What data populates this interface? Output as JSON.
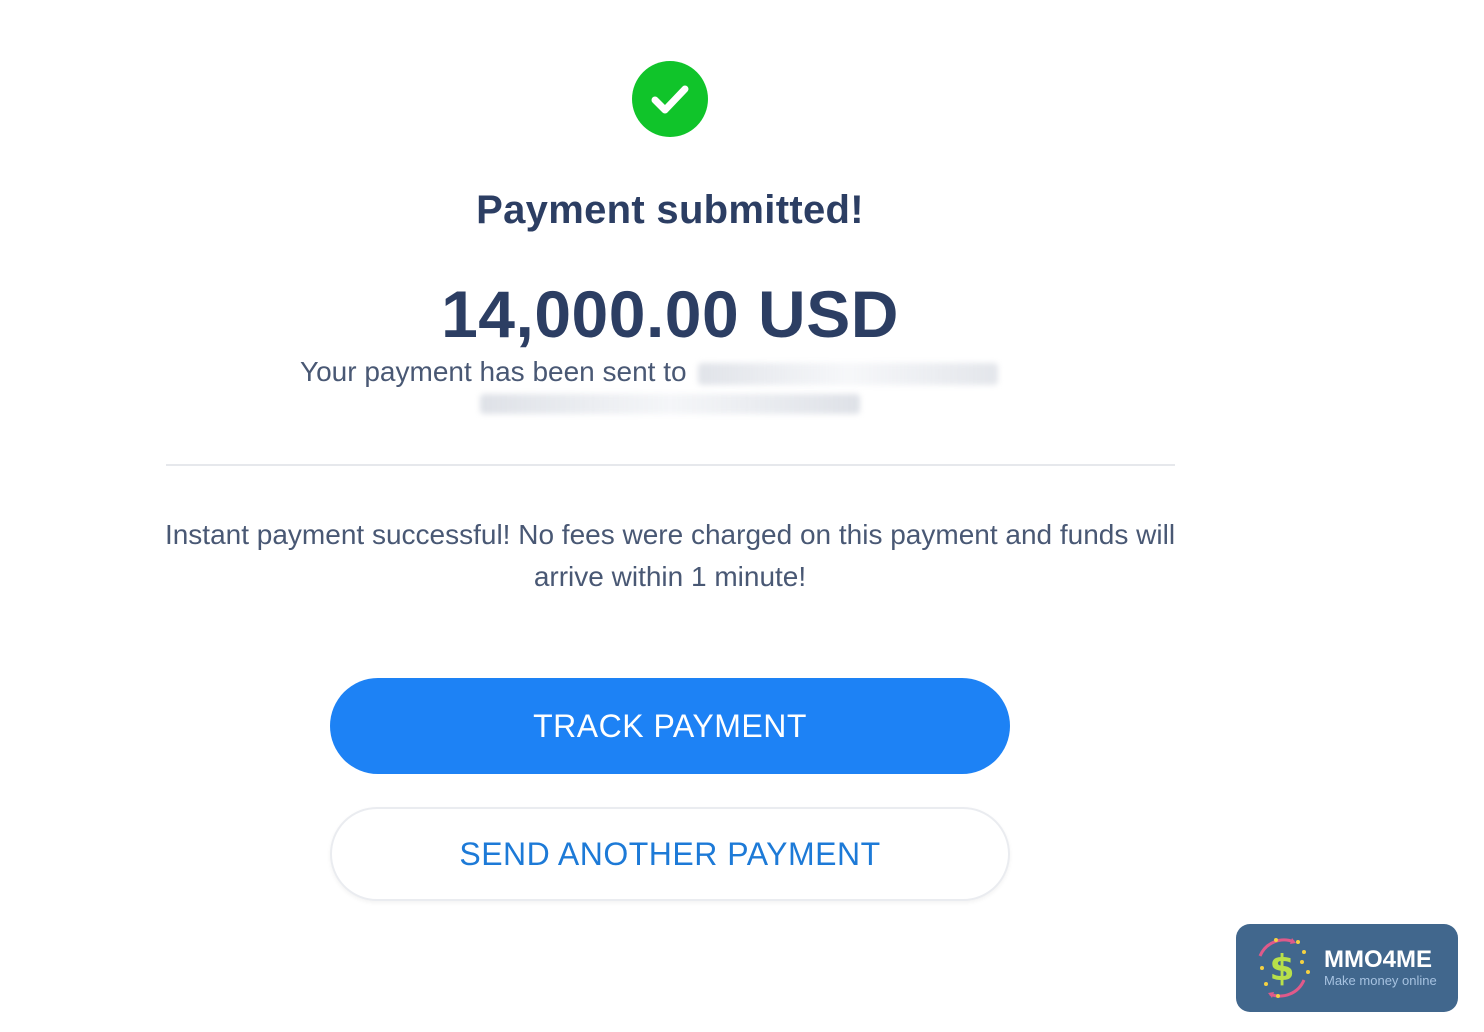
{
  "status": {
    "icon": "check-circle-icon",
    "title": "Payment submitted!"
  },
  "payment": {
    "amount": "14,000.00 USD",
    "recipient_prefix": "Your payment has been sent to"
  },
  "info": {
    "message": "Instant payment successful! No fees were charged on this payment and funds will arrive within 1 minute!"
  },
  "actions": {
    "track_label": "TRACK PAYMENT",
    "send_another_label": "SEND ANOTHER PAYMENT"
  },
  "watermark": {
    "brand": "MMO4ME",
    "tagline": "Make money online",
    "icon": "dollar-stars-icon"
  },
  "colors": {
    "success": "#10c42a",
    "primary": "#1d82f5",
    "text_dark": "#2c3e63",
    "text_body": "#495874",
    "watermark_bg": "#41678d"
  }
}
